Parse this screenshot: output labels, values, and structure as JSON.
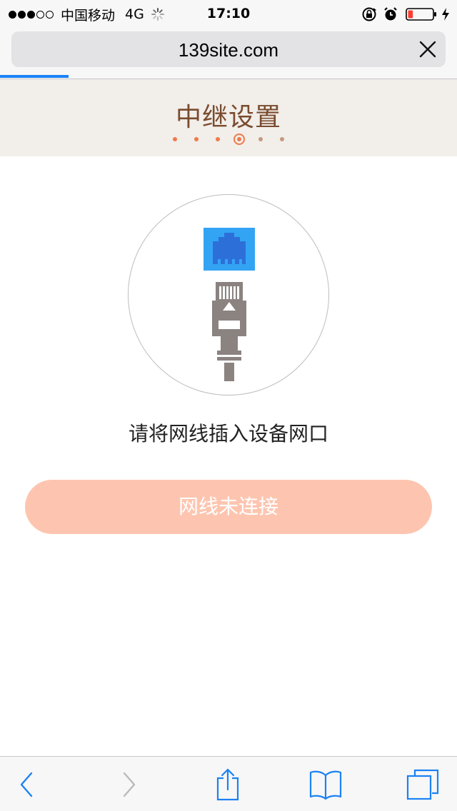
{
  "status_bar": {
    "carrier": "中国移动",
    "network": "4G",
    "time": "17:10",
    "signal_bars_filled": 3,
    "signal_bars_total": 5,
    "battery_level": 0.2
  },
  "browser": {
    "url": "139site.com",
    "page_load_progress": 0.15
  },
  "page": {
    "title": "中继设置",
    "steps_total": 6,
    "current_step": 4,
    "hint": "请将网线插入设备网口",
    "button_label": "网线未连接"
  },
  "colors": {
    "title": "#7a4b2e",
    "accent": "#ef7a4a",
    "button_bg": "#fdc5b0",
    "header_bg": "#f2eeea",
    "port_blue": "#2d7be5",
    "port_bg": "#33a4f4",
    "cable_grey": "#8a8380",
    "ios_blue": "#1b82f5"
  },
  "icons": {
    "ethernet_port": "ethernet-port-icon",
    "ethernet_plug": "ethernet-plug-icon",
    "back": "chevron-left-icon",
    "forward": "chevron-right-icon",
    "share": "share-icon",
    "bookmarks": "book-icon",
    "tabs": "tabs-icon",
    "close": "close-icon"
  }
}
